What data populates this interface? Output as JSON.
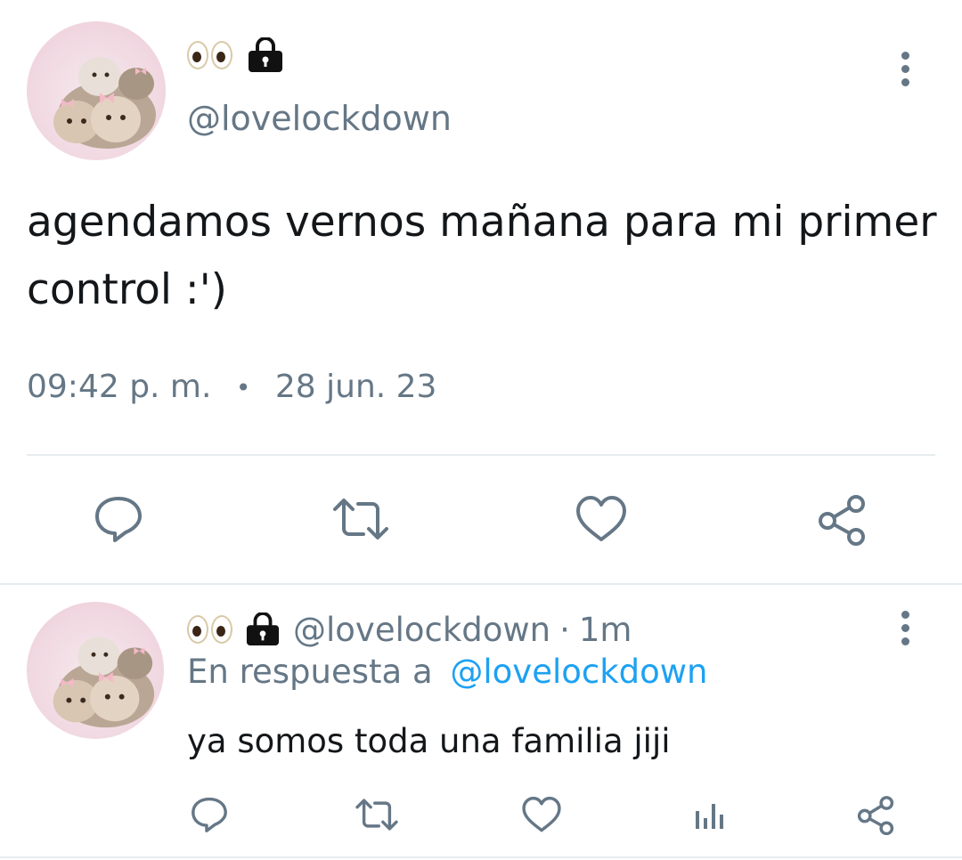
{
  "main_tweet": {
    "handle": "@lovelockdown",
    "name_emojis": [
      "eyes-emoji",
      "lock-icon"
    ],
    "text": "agendamos vernos mañana para mi primer control :')",
    "time": "09:42 p. m.",
    "separator": "•",
    "date": "28 jun. 23"
  },
  "reply_tweet": {
    "handle": "@lovelockdown",
    "meta_separator": "·",
    "age": "1m",
    "reply_prefix": "En respuesta a",
    "reply_to": "@lovelockdown",
    "text": "ya somos toda una familia jiji"
  },
  "colors": {
    "text": "#14171a",
    "muted": "#657786",
    "link": "#1da1f2",
    "divider": "#e6ecf0"
  }
}
